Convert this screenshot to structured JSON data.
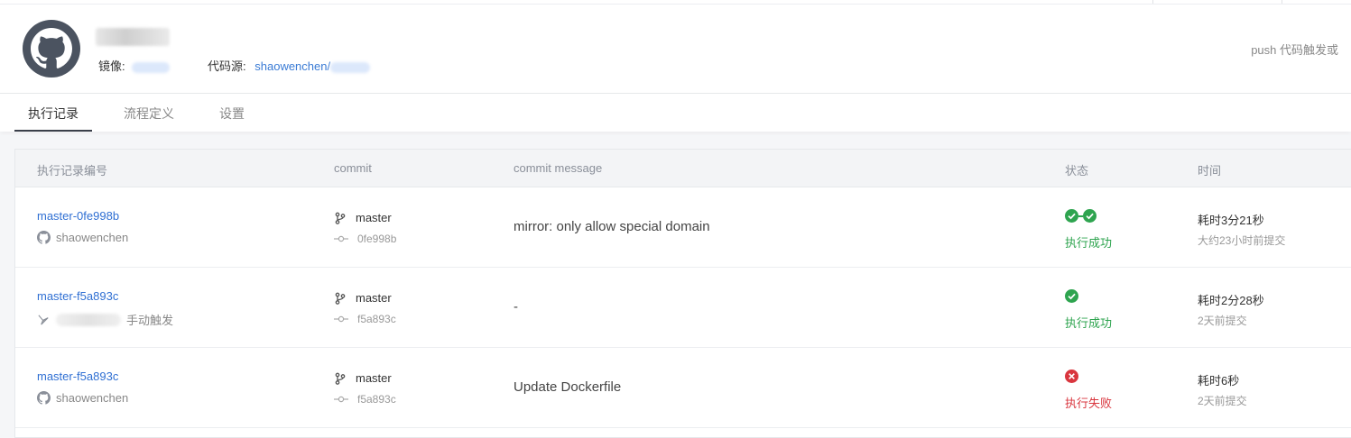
{
  "header": {
    "mirror_label": "镜像:",
    "source_label": "代码源:",
    "source_value": "shaowenchen/",
    "trigger_hint": "push 代码触发或"
  },
  "tabs": [
    {
      "label": "执行记录",
      "active": true
    },
    {
      "label": "流程定义",
      "active": false
    },
    {
      "label": "设置",
      "active": false
    }
  ],
  "table": {
    "columns": [
      "执行记录编号",
      "commit",
      "commit message",
      "状态",
      "时间"
    ],
    "rows": [
      {
        "run_id": "master-0fe998b",
        "trigger": "shaowenchen",
        "trigger_icon": "github-icon",
        "branch": "master",
        "sha": "0fe998b",
        "message": "mirror: only allow special domain",
        "status": "执行成功",
        "status_kind": "success",
        "stages": 2,
        "duration": "耗时3分21秒",
        "ago": "大约23小时前提交"
      },
      {
        "run_id": "master-f5a893c",
        "trigger": "手动触发",
        "trigger_icon": "manual-trigger-icon",
        "branch": "master",
        "sha": "f5a893c",
        "message": "-",
        "status": "执行成功",
        "status_kind": "success",
        "stages": 1,
        "duration": "耗时2分28秒",
        "ago": "2天前提交"
      },
      {
        "run_id": "master-f5a893c",
        "trigger": "shaowenchen",
        "trigger_icon": "github-icon",
        "branch": "master",
        "sha": "f5a893c",
        "message": "Update Dockerfile",
        "status": "执行失败",
        "status_kind": "failure",
        "stages": 1,
        "duration": "耗时6秒",
        "ago": "2天前提交"
      }
    ]
  },
  "colors": {
    "accent": "#2f6fd3",
    "success": "#2ea44f",
    "failure": "#d9363e"
  }
}
